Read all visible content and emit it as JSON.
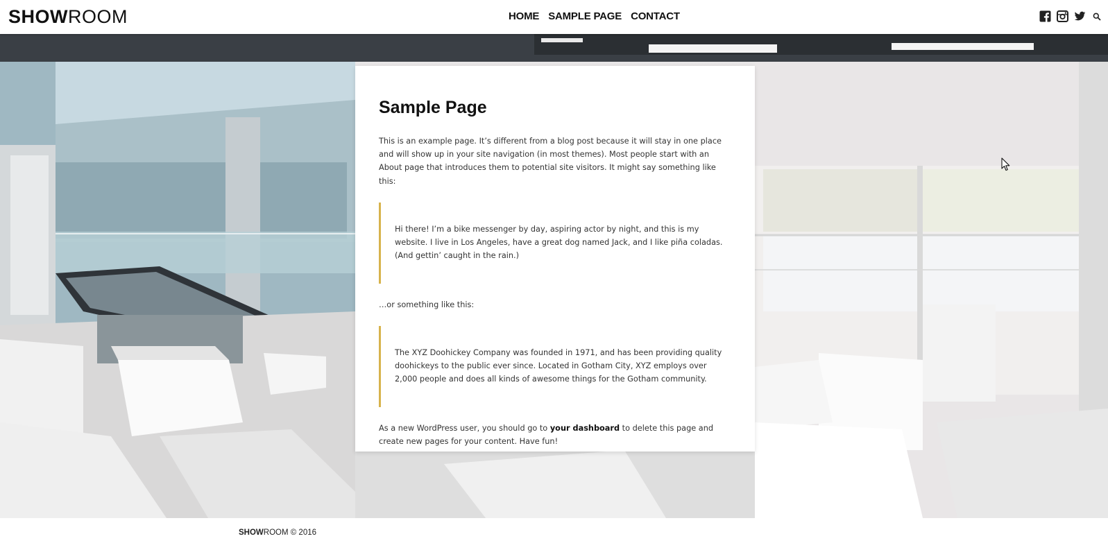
{
  "site": {
    "logo_bold": "SHOW",
    "logo_light": "ROOM"
  },
  "nav": {
    "items": [
      {
        "label": "HOME"
      },
      {
        "label": "SAMPLE PAGE"
      },
      {
        "label": "CONTACT"
      }
    ]
  },
  "social": {
    "icons": [
      "facebook-icon",
      "instagram-icon",
      "twitter-icon",
      "search-icon"
    ]
  },
  "page": {
    "title": "Sample Page",
    "intro": "This is an example page. It’s different from a blog post because it will stay in one place and will show up in your site navigation (in most themes). Most people start with an About page that introduces them to potential site visitors. It might say something like this:",
    "quote1": "Hi there! I’m a bike messenger by day, aspiring actor by night, and this is my website. I live in Los Angeles, have a great dog named Jack, and I like piña coladas. (And gettin’ caught in the rain.)",
    "between": "…or something like this:",
    "quote2": "The XYZ Doohickey Company was founded in 1971, and has been providing quality doohickeys to the public ever since. Located in Gotham City, XYZ employs over 2,000 people and does all kinds of awesome things for the Gotham community.",
    "outro_before": "As a new WordPress user, you should go to ",
    "outro_link": "your dashboard",
    "outro_after": " to delete this page and create new pages for your content. Have fun!"
  },
  "footer": {
    "logo_bold": "SHOW",
    "logo_light": "ROOM",
    "copyright": " © 2016"
  },
  "colors": {
    "accent": "#d7b34c",
    "text": "#333333",
    "heading": "#111111"
  }
}
